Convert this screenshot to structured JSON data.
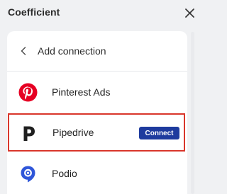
{
  "app": {
    "title": "Coefficient"
  },
  "panel": {
    "title": "Add connection"
  },
  "connections": [
    {
      "label": "Pinterest Ads",
      "icon": "pinterest-icon"
    },
    {
      "label": "Pipedrive",
      "icon": "pipedrive-icon",
      "action_label": "Connect",
      "highlighted": true
    },
    {
      "label": "Podio",
      "icon": "podio-icon"
    }
  ],
  "colors": {
    "highlight_border": "#d9362b",
    "connect_button": "#1e3b9e",
    "pinterest": "#e60023",
    "podio": "#2f56d9"
  }
}
